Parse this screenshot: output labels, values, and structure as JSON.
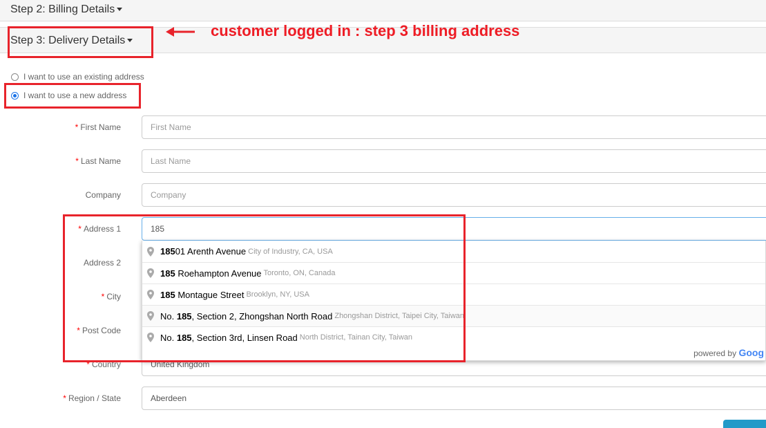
{
  "steps": {
    "step2_title": "Step 2: Billing Details",
    "step3_title": "Step 3: Delivery Details"
  },
  "address_choice": {
    "existing_label": "I want to use an existing address",
    "new_label": "I want to use a new address",
    "selected": "new"
  },
  "form": {
    "required_mark": "*",
    "first_name": {
      "label": "First Name",
      "placeholder": "First Name",
      "required": true
    },
    "last_name": {
      "label": "Last Name",
      "placeholder": "Last Name",
      "required": true
    },
    "company": {
      "label": "Company",
      "placeholder": "Company",
      "required": false
    },
    "address1": {
      "label": "Address 1",
      "value": "185",
      "required": true
    },
    "address2": {
      "label": "Address 2",
      "required": false
    },
    "city": {
      "label": "City",
      "required": true
    },
    "post_code": {
      "label": "Post Code",
      "required": true
    },
    "country": {
      "label": "Country",
      "value": "United Kingdom",
      "required": true
    },
    "region": {
      "label": "Region / State",
      "value": "Aberdeen",
      "required": true
    }
  },
  "autocomplete": {
    "suggestions": [
      {
        "match": "185",
        "rest": "01 Arenth Avenue",
        "secondary": "City of Industry, CA, USA"
      },
      {
        "match": "185",
        "rest": " Roehampton Avenue",
        "secondary": "Toronto, ON, Canada"
      },
      {
        "match": "185",
        "rest": " Montague Street",
        "secondary": "Brooklyn, NY, USA"
      },
      {
        "prefix": "No. ",
        "match": "185",
        "rest": ", Section 2, Zhongshan North Road",
        "secondary": "Zhongshan District, Taipei City, Taiwan"
      },
      {
        "prefix": "No. ",
        "match": "185",
        "rest": ", Section 3rd, Linsen Road",
        "secondary": "North District, Tainan City, Taiwan"
      }
    ],
    "powered_by": "powered by",
    "powered_brand": "Goog"
  },
  "annotation": {
    "text": "customer logged in : step 3 billing address",
    "color": "#ee1c25"
  },
  "colors": {
    "accent": "#1a73e8",
    "annotation": "#e8232b",
    "button": "#229ac8"
  }
}
